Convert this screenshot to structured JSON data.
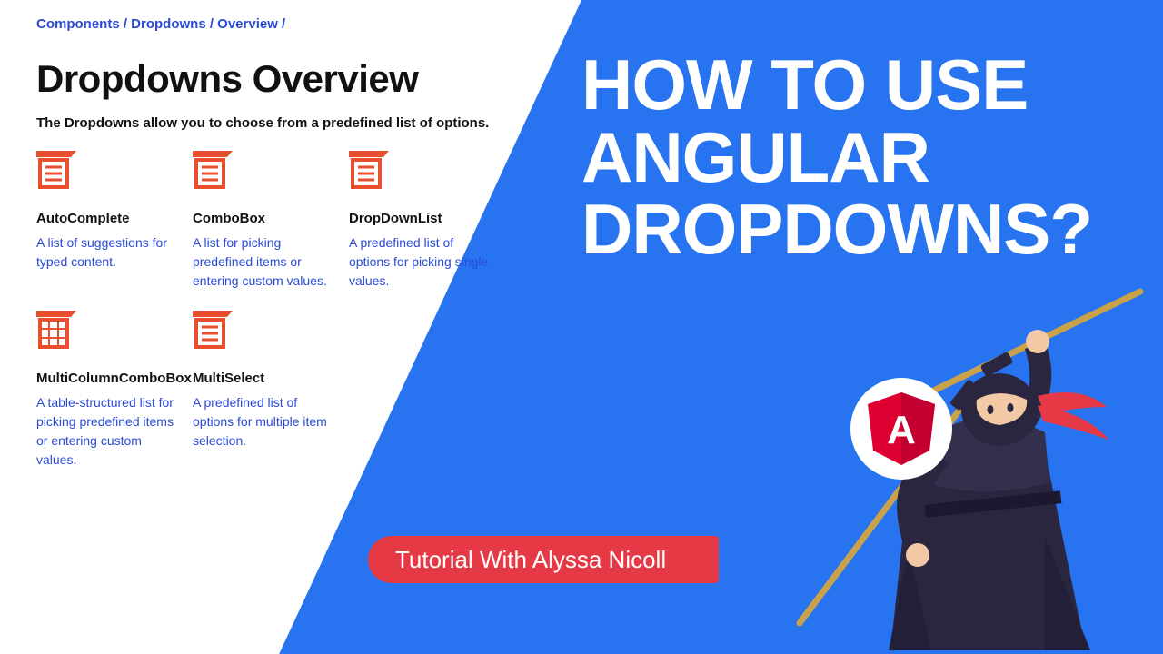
{
  "colors": {
    "blue_panel": "#2874f0",
    "link": "#2a4bd7",
    "accent": "#e63946",
    "icon_fill": "#e94f2e"
  },
  "doc": {
    "breadcrumb": "Components / Dropdowns / Overview /",
    "title": "Dropdowns Overview",
    "subtitle": "The Dropdowns allow you to choose from a predefined list of options.",
    "cards": [
      {
        "icon": "list-icon",
        "title": "AutoComplete",
        "desc": "A list of suggestions for typed content."
      },
      {
        "icon": "list-icon",
        "title": "ComboBox",
        "desc": "A list for picking predefined items or entering custom values."
      },
      {
        "icon": "list-icon",
        "title": "DropDownList",
        "desc": "A predefined list of options for picking single values."
      },
      {
        "icon": "grid-icon",
        "title": "MultiColumnComboBox",
        "desc": "A table-structured list for picking predefined items or entering custom values."
      },
      {
        "icon": "list-icon",
        "title": "MultiSelect",
        "desc": "A predefined list of options for multiple item selection."
      }
    ]
  },
  "right": {
    "headline": "HOW TO USE\nANGULAR\nDROPDOWNS?",
    "ribbon": "Tutorial With Alyssa Nicoll",
    "angular_badge_letter": "A"
  }
}
